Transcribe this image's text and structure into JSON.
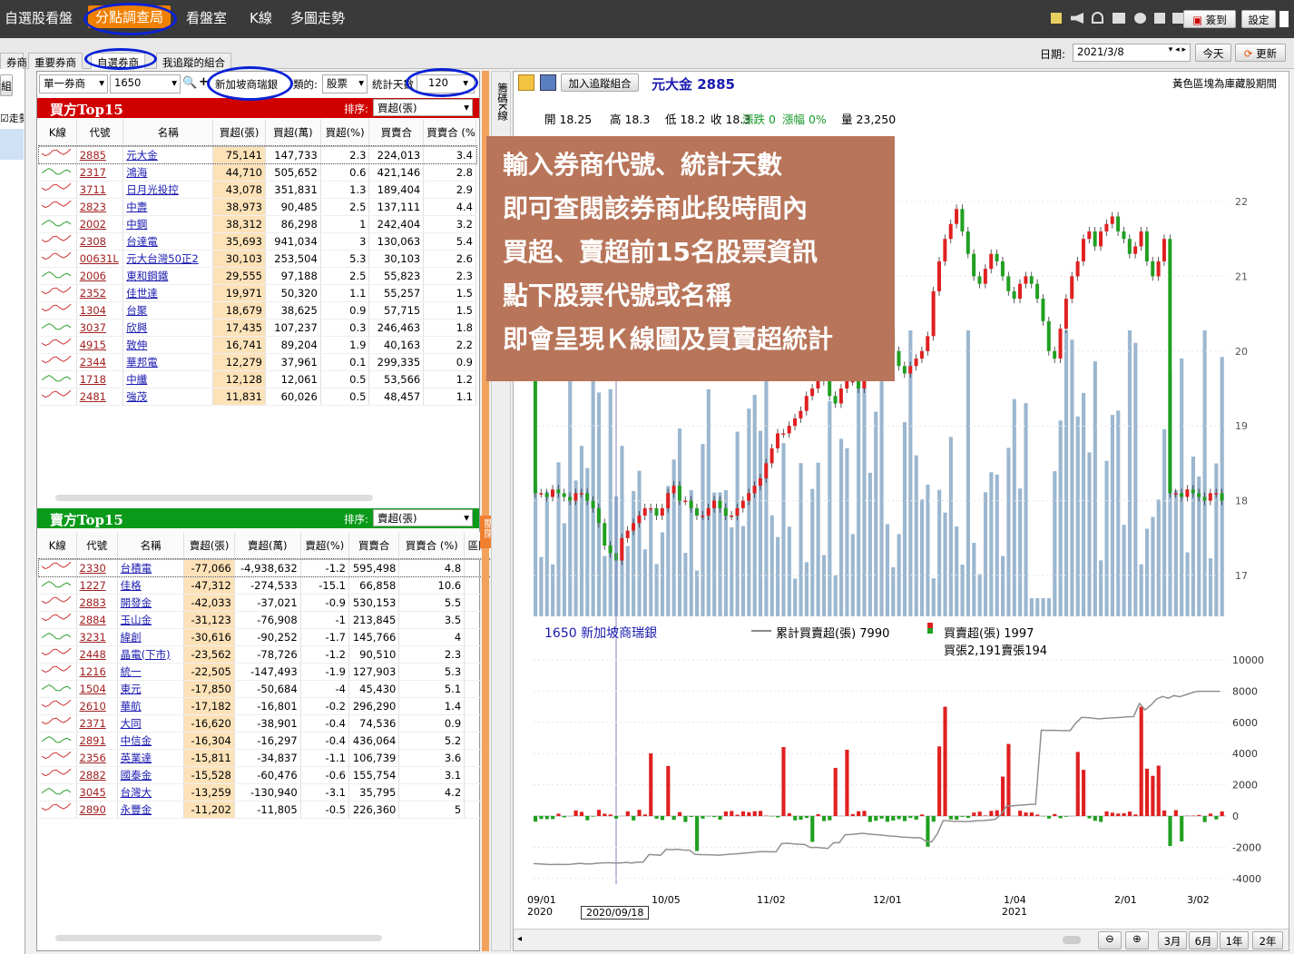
{
  "topnav": {
    "items": [
      "自選股看盤",
      "分點調查局",
      "看盤室",
      "K線",
      "多圖走勢"
    ],
    "sign_label": "簽到",
    "settings_label": "設定"
  },
  "subtabs": {
    "left": "券商",
    "items": [
      "重要券商",
      "自選券商",
      "我追蹤的組合"
    ]
  },
  "date": {
    "label": "日期:",
    "value": "2021/3/8",
    "today": "今天",
    "refresh": "更新"
  },
  "controls": {
    "mode": "單一券商",
    "broker_code": "1650",
    "broker_name": "新加坡商瑞銀",
    "type_label": "類的:",
    "type_value": "股票",
    "days_label": "統計天數",
    "days_value": "120"
  },
  "left_stub": {
    "btn": "組",
    "chk": "走勢"
  },
  "buy": {
    "title": "買方Top15",
    "sort_label": "排序:",
    "sort_value": "買超(張)",
    "columns": [
      "K線",
      "代號",
      "名稱",
      "買超(張)",
      "買超(萬)",
      "買超(%)",
      "買賣合",
      "買賣合 (%)"
    ],
    "rows": [
      [
        "2885",
        "元大金",
        "75,141",
        "147,733",
        "2.3",
        "224,013",
        "3.4"
      ],
      [
        "2317",
        "鴻海",
        "44,710",
        "505,652",
        "0.6",
        "421,146",
        "2.8"
      ],
      [
        "3711",
        "日月光投控",
        "43,078",
        "351,831",
        "1.3",
        "189,404",
        "2.9"
      ],
      [
        "2823",
        "中壽",
        "38,973",
        "90,485",
        "2.5",
        "137,111",
        "4.4"
      ],
      [
        "2002",
        "中鋼",
        "38,312",
        "86,298",
        "1",
        "242,404",
        "3.2"
      ],
      [
        "2308",
        "台達電",
        "35,693",
        "941,034",
        "3",
        "130,063",
        "5.4"
      ],
      [
        "00631L",
        "元大台灣50正2",
        "30,103",
        "253,504",
        "5.3",
        "30,103",
        "2.6"
      ],
      [
        "2006",
        "東和鋼鐵",
        "29,555",
        "97,188",
        "2.5",
        "55,823",
        "2.3"
      ],
      [
        "2352",
        "佳世達",
        "19,971",
        "50,320",
        "1.1",
        "55,257",
        "1.5"
      ],
      [
        "1304",
        "台聚",
        "18,679",
        "38,625",
        "0.9",
        "57,715",
        "1.5"
      ],
      [
        "3037",
        "欣興",
        "17,435",
        "107,237",
        "0.3",
        "246,463",
        "1.8"
      ],
      [
        "4915",
        "致伸",
        "16,741",
        "89,204",
        "1.9",
        "40,163",
        "2.2"
      ],
      [
        "2344",
        "華邦電",
        "12,279",
        "37,961",
        "0.1",
        "299,335",
        "0.9"
      ],
      [
        "1718",
        "中纖",
        "12,128",
        "12,061",
        "0.5",
        "53,566",
        "1.2"
      ],
      [
        "2481",
        "強茂",
        "11,831",
        "60,026",
        "0.5",
        "48,457",
        "1.1"
      ]
    ]
  },
  "sell": {
    "title": "賣方Top15",
    "sort_label": "排序:",
    "sort_value": "賣超(張)",
    "columns": [
      "K線",
      "代號",
      "名稱",
      "賣超(張)",
      "賣超(萬)",
      "賣超(%)",
      "買賣合",
      "買賣合 (%)",
      "區間"
    ],
    "rows": [
      [
        "2330",
        "台積電",
        "-77,066",
        "-4,938,632",
        "-1.2",
        "595,498",
        "4.8"
      ],
      [
        "1227",
        "佳格",
        "-47,312",
        "-274,533",
        "-15.1",
        "66,858",
        "10.6"
      ],
      [
        "2883",
        "開發金",
        "-42,033",
        "-37,021",
        "-0.9",
        "530,153",
        "5.5"
      ],
      [
        "2884",
        "玉山金",
        "-31,123",
        "-76,908",
        "-1",
        "213,845",
        "3.5"
      ],
      [
        "3231",
        "緯創",
        "-30,616",
        "-90,252",
        "-1.7",
        "145,766",
        "4"
      ],
      [
        "2448",
        "晶電(下市)",
        "-23,562",
        "-78,726",
        "-1.2",
        "90,510",
        "2.3"
      ],
      [
        "1216",
        "統一",
        "-22,505",
        "-147,493",
        "-1.9",
        "127,903",
        "5.3"
      ],
      [
        "1504",
        "東元",
        "-17,850",
        "-50,684",
        "-4",
        "45,430",
        "5.1"
      ],
      [
        "2610",
        "華航",
        "-17,182",
        "-16,801",
        "-0.2",
        "296,290",
        "1.4"
      ],
      [
        "2371",
        "大同",
        "-16,620",
        "-38,901",
        "-0.4",
        "74,536",
        "0.9"
      ],
      [
        "2891",
        "中信金",
        "-16,304",
        "-16,297",
        "-0.4",
        "436,064",
        "5.2"
      ],
      [
        "2356",
        "英業達",
        "-15,811",
        "-34,837",
        "-1.1",
        "106,739",
        "3.6"
      ],
      [
        "2882",
        "國泰金",
        "-15,528",
        "-60,476",
        "-0.6",
        "155,754",
        "3.1"
      ],
      [
        "3045",
        "台灣大",
        "-13,259",
        "-130,940",
        "-3.1",
        "35,795",
        "4.2"
      ],
      [
        "2890",
        "永豐金",
        "-11,202",
        "-11,805",
        "-0.5",
        "226,360",
        "5"
      ]
    ]
  },
  "side_tab": "籌碼K線",
  "side_close": "關閉",
  "chart_toolbar": {
    "add_label": "加入追蹤組合",
    "stock": "元大金 2885",
    "note": "黃色區塊為庫藏股期間"
  },
  "ohlc": {
    "open": "開 18.25",
    "high": "高 18.3",
    "low": "低 18.2",
    "close": "收 18.3",
    "chg": "漲跌 0",
    "pct": "漲幅 0%",
    "vol": "量 23,250"
  },
  "callout": [
    "輸入券商代號、統計天數",
    "即可查閱該券商此段時間內",
    "買超、賣超前15名股票資訊",
    "點下股票代號或名稱",
    "即會呈現Ｋ線圖及買賣超統計"
  ],
  "lower_legend": {
    "broker": "1650 新加坡商瑞銀",
    "cum": "累計買賣超(張) 7990",
    "net": "買賣超(張) 1997",
    "detail": "買張2,191賣張194"
  },
  "xaxis": {
    "labels": [
      "09/01",
      "10/05",
      "11/02",
      "12/01",
      "1/04",
      "2/01",
      "3/02"
    ],
    "years": [
      "2020",
      "2021"
    ],
    "cursor_date": "2020/09/18"
  },
  "zoom": {
    "buttons": [
      "3月",
      "6月",
      "1年",
      "2年"
    ]
  },
  "chart_data": {
    "type": "candlestick+bar",
    "price_axis": [
      17,
      18,
      19,
      20,
      21,
      22
    ],
    "vol_color": "#9bb7d0",
    "lower_axis": [
      -4000,
      -2000,
      0,
      2000,
      4000,
      6000,
      8000,
      10000
    ],
    "up_color": "#e02020",
    "down_color": "#20a020"
  }
}
